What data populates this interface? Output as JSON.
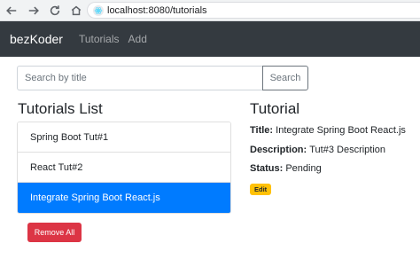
{
  "browser": {
    "url": "localhost:8080/tutorials"
  },
  "navbar": {
    "brand": "bezKoder",
    "links": [
      "Tutorials",
      "Add"
    ]
  },
  "search": {
    "placeholder": "Search by title",
    "button_label": "Search"
  },
  "list": {
    "title": "Tutorials List",
    "items": [
      {
        "label": "Spring Boot Tut#1",
        "active": false
      },
      {
        "label": "React Tut#2",
        "active": false
      },
      {
        "label": "Integrate Spring Boot React.js",
        "active": true
      }
    ],
    "remove_all_label": "Remove All"
  },
  "detail": {
    "heading": "Tutorial",
    "title_label": "Title:",
    "title_value": "Integrate Spring Boot React.js",
    "description_label": "Description:",
    "description_value": "Tut#3 Description",
    "status_label": "Status:",
    "status_value": "Pending",
    "edit_label": "Edit"
  },
  "colors": {
    "navbar_bg": "#343a40",
    "active_item": "#007bff",
    "danger": "#dc3545",
    "warning": "#ffc107"
  },
  "icons": [
    "back-arrow-icon",
    "forward-arrow-icon",
    "reload-icon",
    "home-icon",
    "site-info-icon"
  ]
}
